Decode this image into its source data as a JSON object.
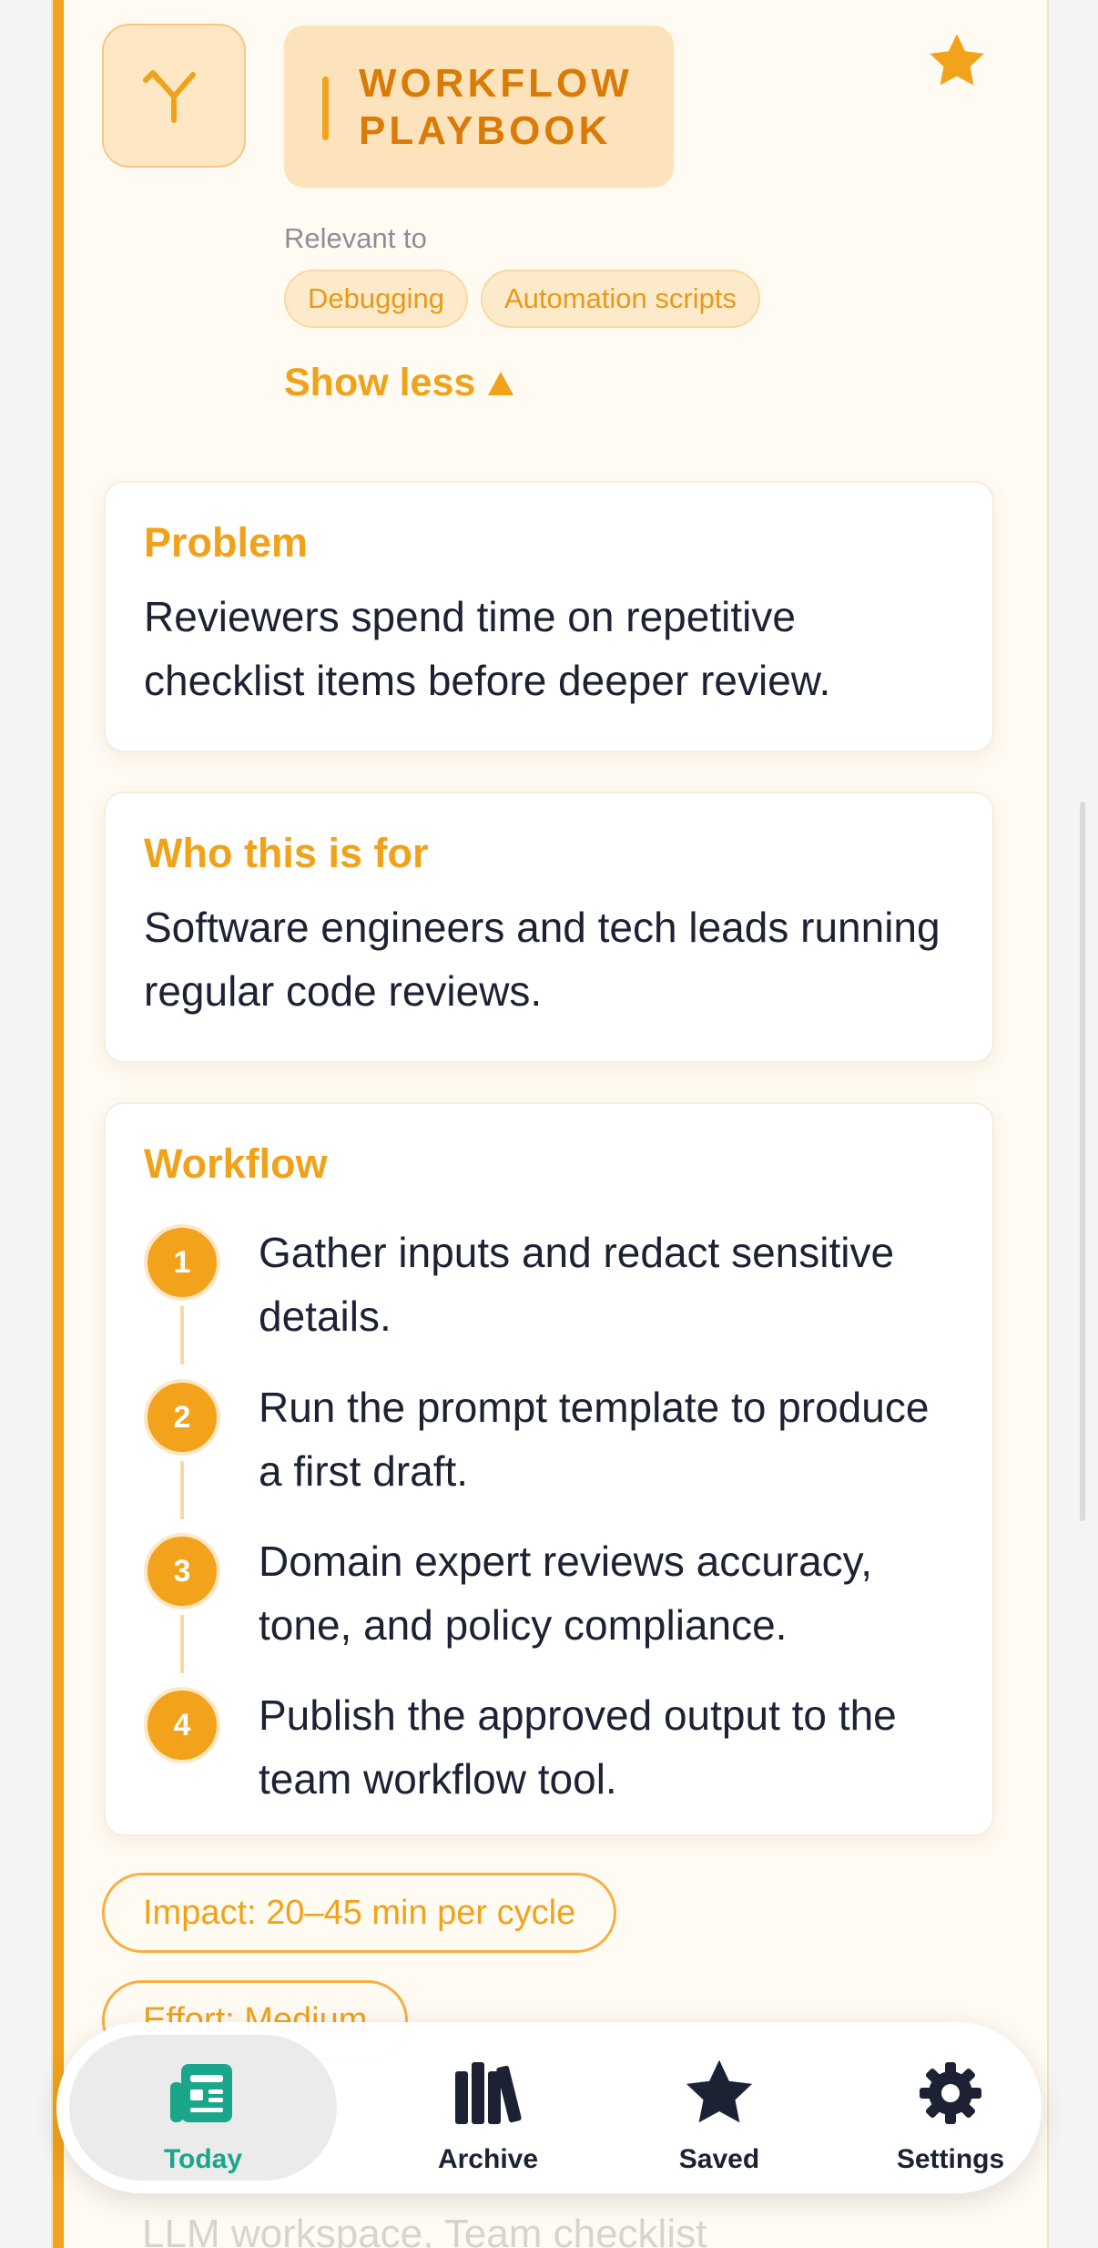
{
  "card": {
    "type_label": "WORKFLOW PLAYBOOK",
    "type_icon": "branch-icon",
    "favorite_icon": "star-icon",
    "relevant_label": "Relevant to",
    "tags": [
      "Debugging",
      "Automation scripts"
    ],
    "toggle_label": "Show less",
    "problem": {
      "title": "Problem",
      "text": "Reviewers spend time on repetitive checklist items before deeper review."
    },
    "audience": {
      "title": "Who this is for",
      "text": "Software engineers and tech leads running regular code reviews."
    },
    "workflow": {
      "title": "Workflow",
      "steps": [
        {
          "num": "1",
          "text": "Gather inputs and redact sensitive details."
        },
        {
          "num": "2",
          "text": "Run the prompt template to produce a first draft."
        },
        {
          "num": "3",
          "text": "Domain expert reviews accuracy, tone, and policy compliance."
        },
        {
          "num": "4",
          "text": "Publish the approved output to the team workflow tool."
        }
      ]
    },
    "impact": "Impact: 20–45 min per cycle",
    "effort": "Effort: Medium",
    "tools": "LLM workspace, Team checklist"
  },
  "tabbar": {
    "items": [
      {
        "label": "Today",
        "icon": "newspaper-icon",
        "active": true
      },
      {
        "label": "Archive",
        "icon": "books-icon",
        "active": false
      },
      {
        "label": "Saved",
        "icon": "star-icon",
        "active": false
      },
      {
        "label": "Settings",
        "icon": "gear-icon",
        "active": false
      }
    ]
  },
  "colors": {
    "accent": "#f2a31b",
    "active_tab": "#1aa68a",
    "text": "#1c2233"
  }
}
